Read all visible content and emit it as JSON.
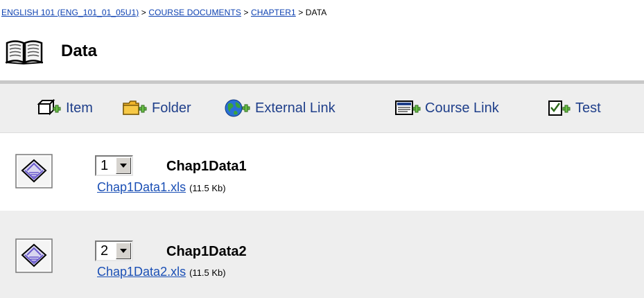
{
  "breadcrumb": {
    "course": "ENGLISH 101 (ENG_101_01_05U1)",
    "documents": "COURSE DOCUMENTS",
    "chapter": "CHAPTER1",
    "current": "DATA",
    "separator": ">"
  },
  "page": {
    "title": "Data",
    "icon": "book-icon"
  },
  "toolbar": {
    "item_label": "Item",
    "folder_label": "Folder",
    "external_link_label": "External Link",
    "course_link_label": "Course Link",
    "test_label": "Test"
  },
  "items": [
    {
      "order": "1",
      "name": "Chap1Data1",
      "file": "Chap1Data1.xls",
      "size": "(11.5 Kb)"
    },
    {
      "order": "2",
      "name": "Chap1Data2",
      "file": "Chap1Data2.xls",
      "size": "(11.5 Kb)"
    }
  ],
  "colors": {
    "link": "#1a4fb5",
    "toolbar_bg": "#eeeeee",
    "row_alt_bg": "#eeeeee",
    "rule": "#c8c8c8"
  }
}
